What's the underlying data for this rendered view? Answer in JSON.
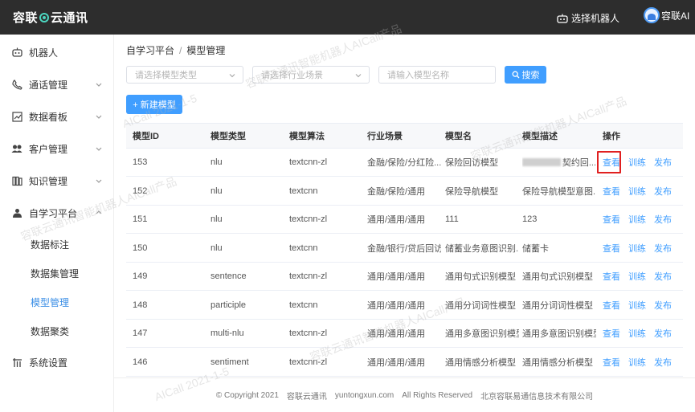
{
  "header": {
    "brand_left": "容联",
    "brand_right": "云通讯",
    "robot_select_label": "选择机器人",
    "user_name": "容联AI"
  },
  "sidebar": {
    "items": [
      {
        "label": "机器人",
        "icon": "robot-icon"
      },
      {
        "label": "通话管理",
        "icon": "phone-icon"
      },
      {
        "label": "数据看板",
        "icon": "chart-icon"
      },
      {
        "label": "客户管理",
        "icon": "people-icon"
      },
      {
        "label": "知识管理",
        "icon": "book-icon"
      },
      {
        "label": "自学习平台",
        "icon": "learn-icon"
      },
      {
        "label": "系统设置",
        "icon": "settings-icon"
      }
    ],
    "sub_items": [
      "数据标注",
      "数据集管理",
      "模型管理",
      "数据聚类"
    ],
    "active_sub": "模型管理"
  },
  "breadcrumb": [
    "自学习平台",
    "模型管理"
  ],
  "filters": {
    "model_type_placeholder": "请选择模型类型",
    "scene_placeholder": "请选择行业场景",
    "name_placeholder": "请输入模型名称",
    "search_label": "搜索"
  },
  "new_model_label": "+ 新建模型",
  "table": {
    "columns": [
      "模型ID",
      "模型类型",
      "模型算法",
      "行业场景",
      "模型名",
      "模型描述",
      "操作"
    ],
    "rows": [
      {
        "id": "153",
        "type": "nlu",
        "algo": "textcnn-zl",
        "scene": "金融/保险/分红险...",
        "name": "保险回访模型",
        "desc": "契约回..."
      },
      {
        "id": "152",
        "type": "nlu",
        "algo": "textcnn",
        "scene": "金融/保险/通用",
        "name": "保险导航模型",
        "desc": "保险导航模型意图..."
      },
      {
        "id": "151",
        "type": "nlu",
        "algo": "textcnn-zl",
        "scene": "通用/通用/通用",
        "name": "111",
        "desc": "123"
      },
      {
        "id": "150",
        "type": "nlu",
        "algo": "textcnn",
        "scene": "金融/银行/贷后回访",
        "name": "储蓄业务意图识别...",
        "desc": "储蓄卡"
      },
      {
        "id": "149",
        "type": "sentence",
        "algo": "textcnn-zl",
        "scene": "通用/通用/通用",
        "name": "通用句式识别模型",
        "desc": "通用句式识别模型"
      },
      {
        "id": "148",
        "type": "participle",
        "algo": "textcnn",
        "scene": "通用/通用/通用",
        "name": "通用分词词性模型",
        "desc": "通用分词词性模型"
      },
      {
        "id": "147",
        "type": "multi-nlu",
        "algo": "textcnn-zl",
        "scene": "通用/通用/通用",
        "name": "通用多意图识别模型",
        "desc": "通用多意图识别模型"
      },
      {
        "id": "146",
        "type": "sentiment",
        "algo": "textcnn-zl",
        "scene": "通用/通用/通用",
        "name": "通用情感分析模型",
        "desc": "通用情感分析模型"
      }
    ],
    "actions": [
      "查看",
      "训练",
      "发布"
    ]
  },
  "footer": {
    "copyright": "© Copyright 2021",
    "brand": "容联云通讯",
    "domain": "yuntongxun.com",
    "rights": "All Rights Reserved",
    "company": "北京容联易通信息技术有限公司"
  },
  "watermark": {
    "text1": "容联云通讯智能机器人AICall产品",
    "text2": "AICall 2021-1-5"
  },
  "colors": {
    "topbar": "#2d2d2d",
    "accent": "#409eff",
    "highlight": "#e02020"
  }
}
